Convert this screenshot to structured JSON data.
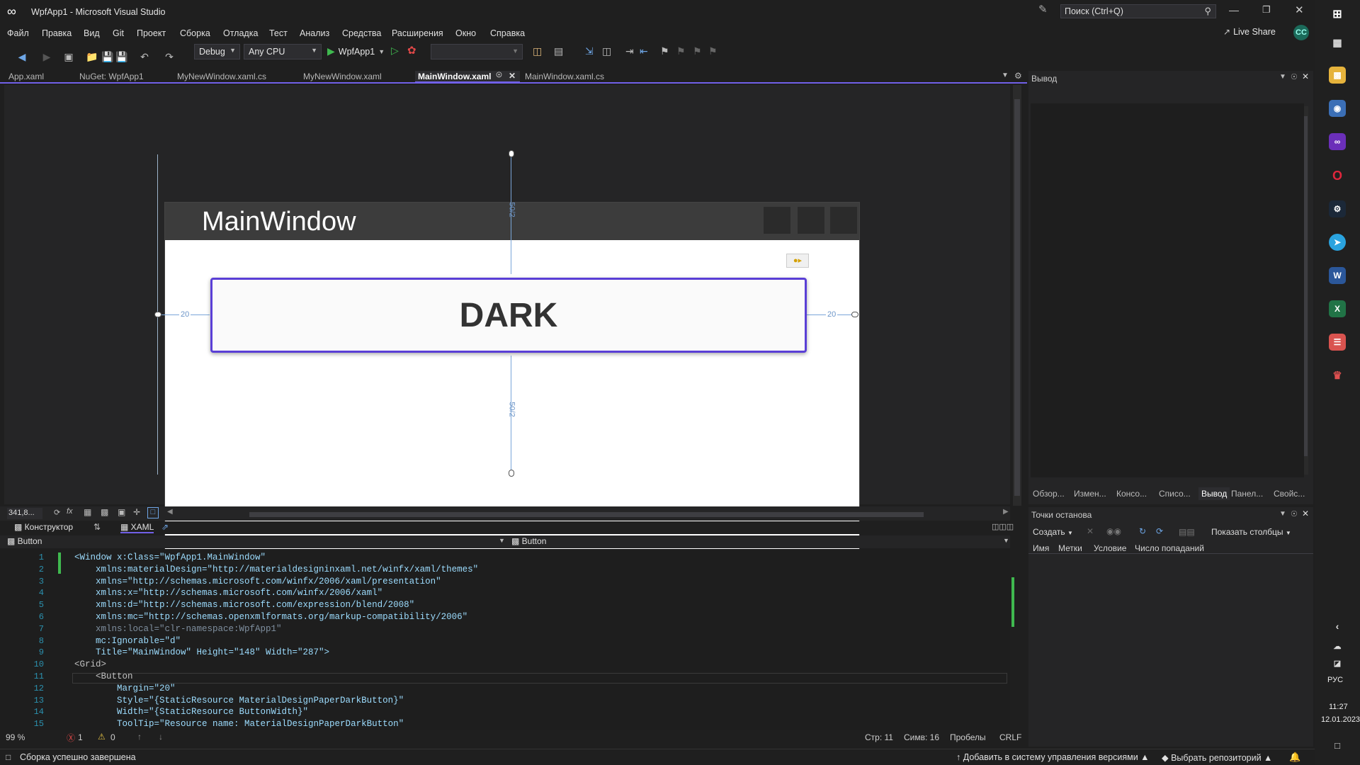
{
  "window": {
    "title": "WpfApp1 - Microsoft Visual Studio",
    "search_placeholder": "Поиск (Ctrl+Q)",
    "live_share": "Live Share",
    "user_initials": "CC"
  },
  "menu": [
    "Файл",
    "Правка",
    "Вид",
    "Git",
    "Проект",
    "Сборка",
    "Отладка",
    "Тест",
    "Анализ",
    "Средства",
    "Расширения",
    "Окно",
    "Справка"
  ],
  "toolbar": {
    "config": "Debug",
    "platform": "Any CPU",
    "run_target": "WpfApp1"
  },
  "tabs": [
    "App.xaml",
    "NuGet: WpfApp1",
    "MyNewWindow.xaml.cs",
    "MyNewWindow.xaml",
    "MainWindow.xaml",
    "MainWindow.xaml.cs"
  ],
  "designer": {
    "window_title": "MainWindow",
    "button_text": "DARK",
    "margin_top": "50/2",
    "margin_bottom": "50/2",
    "margin_left": "20",
    "margin_right": "20"
  },
  "view": {
    "zoom": "341,8...",
    "designer_tab": "Конструктор",
    "xaml_tab": "XAML"
  },
  "nav": {
    "left": "Button",
    "right": "Button"
  },
  "code_lines": [
    {
      "n": "1",
      "t": "<Window x:Class=\"WpfApp1.MainWindow\""
    },
    {
      "n": "2",
      "t": "    xmlns:materialDesign=\"http://materialdesigninxaml.net/winfx/xaml/themes\""
    },
    {
      "n": "3",
      "t": "    xmlns=\"http://schemas.microsoft.com/winfx/2006/xaml/presentation\""
    },
    {
      "n": "4",
      "t": "    xmlns:x=\"http://schemas.microsoft.com/winfx/2006/xaml\""
    },
    {
      "n": "5",
      "t": "    xmlns:d=\"http://schemas.microsoft.com/expression/blend/2008\""
    },
    {
      "n": "6",
      "t": "    xmlns:mc=\"http://schemas.openxmlformats.org/markup-compatibility/2006\""
    },
    {
      "n": "7",
      "t": "    xmlns:local=\"clr-namespace:WpfApp1\""
    },
    {
      "n": "8",
      "t": "    mc:Ignorable=\"d\""
    },
    {
      "n": "9",
      "t": "    Title=\"MainWindow\" Height=\"148\" Width=\"287\">"
    },
    {
      "n": "10",
      "t": "<Grid>"
    },
    {
      "n": "11",
      "t": "    <Button"
    },
    {
      "n": "12",
      "t": "        Margin=\"20\""
    },
    {
      "n": "13",
      "t": "        Style=\"{StaticResource MaterialDesignPaperDarkButton}\""
    },
    {
      "n": "14",
      "t": "        Width=\"{StaticResource ButtonWidth}\""
    },
    {
      "n": "15",
      "t": "        ToolTip=\"Resource name: MaterialDesignPaperDarkButton\""
    }
  ],
  "editor_status": {
    "zoom": "99 %",
    "errors": "1",
    "warnings": "0",
    "line": "Стр: 11",
    "col": "Симв: 16",
    "spaces": "Пробелы",
    "eol": "CRLF"
  },
  "output_panel": {
    "title": "Вывод",
    "tabs": [
      "Обзор...",
      "Измен...",
      "Консо...",
      "Списо...",
      "Вывод",
      "Панел...",
      "Свойс..."
    ]
  },
  "breakpoints": {
    "title": "Точки останова",
    "create": "Создать",
    "show_columns": "Показать столбцы",
    "columns": [
      "Имя",
      "Метки",
      "Условие",
      "Число попаданий"
    ]
  },
  "status": {
    "message": "Сборка успешно завершена",
    "source_control": "Добавить в систему управления версиями",
    "repo": "Выбрать репозиторий"
  },
  "tray": {
    "lang": "РУС",
    "time": "11:27",
    "date": "12.01.2023"
  },
  "colors": {
    "accent": "#7160e8",
    "bg": "#1f1f1f"
  }
}
